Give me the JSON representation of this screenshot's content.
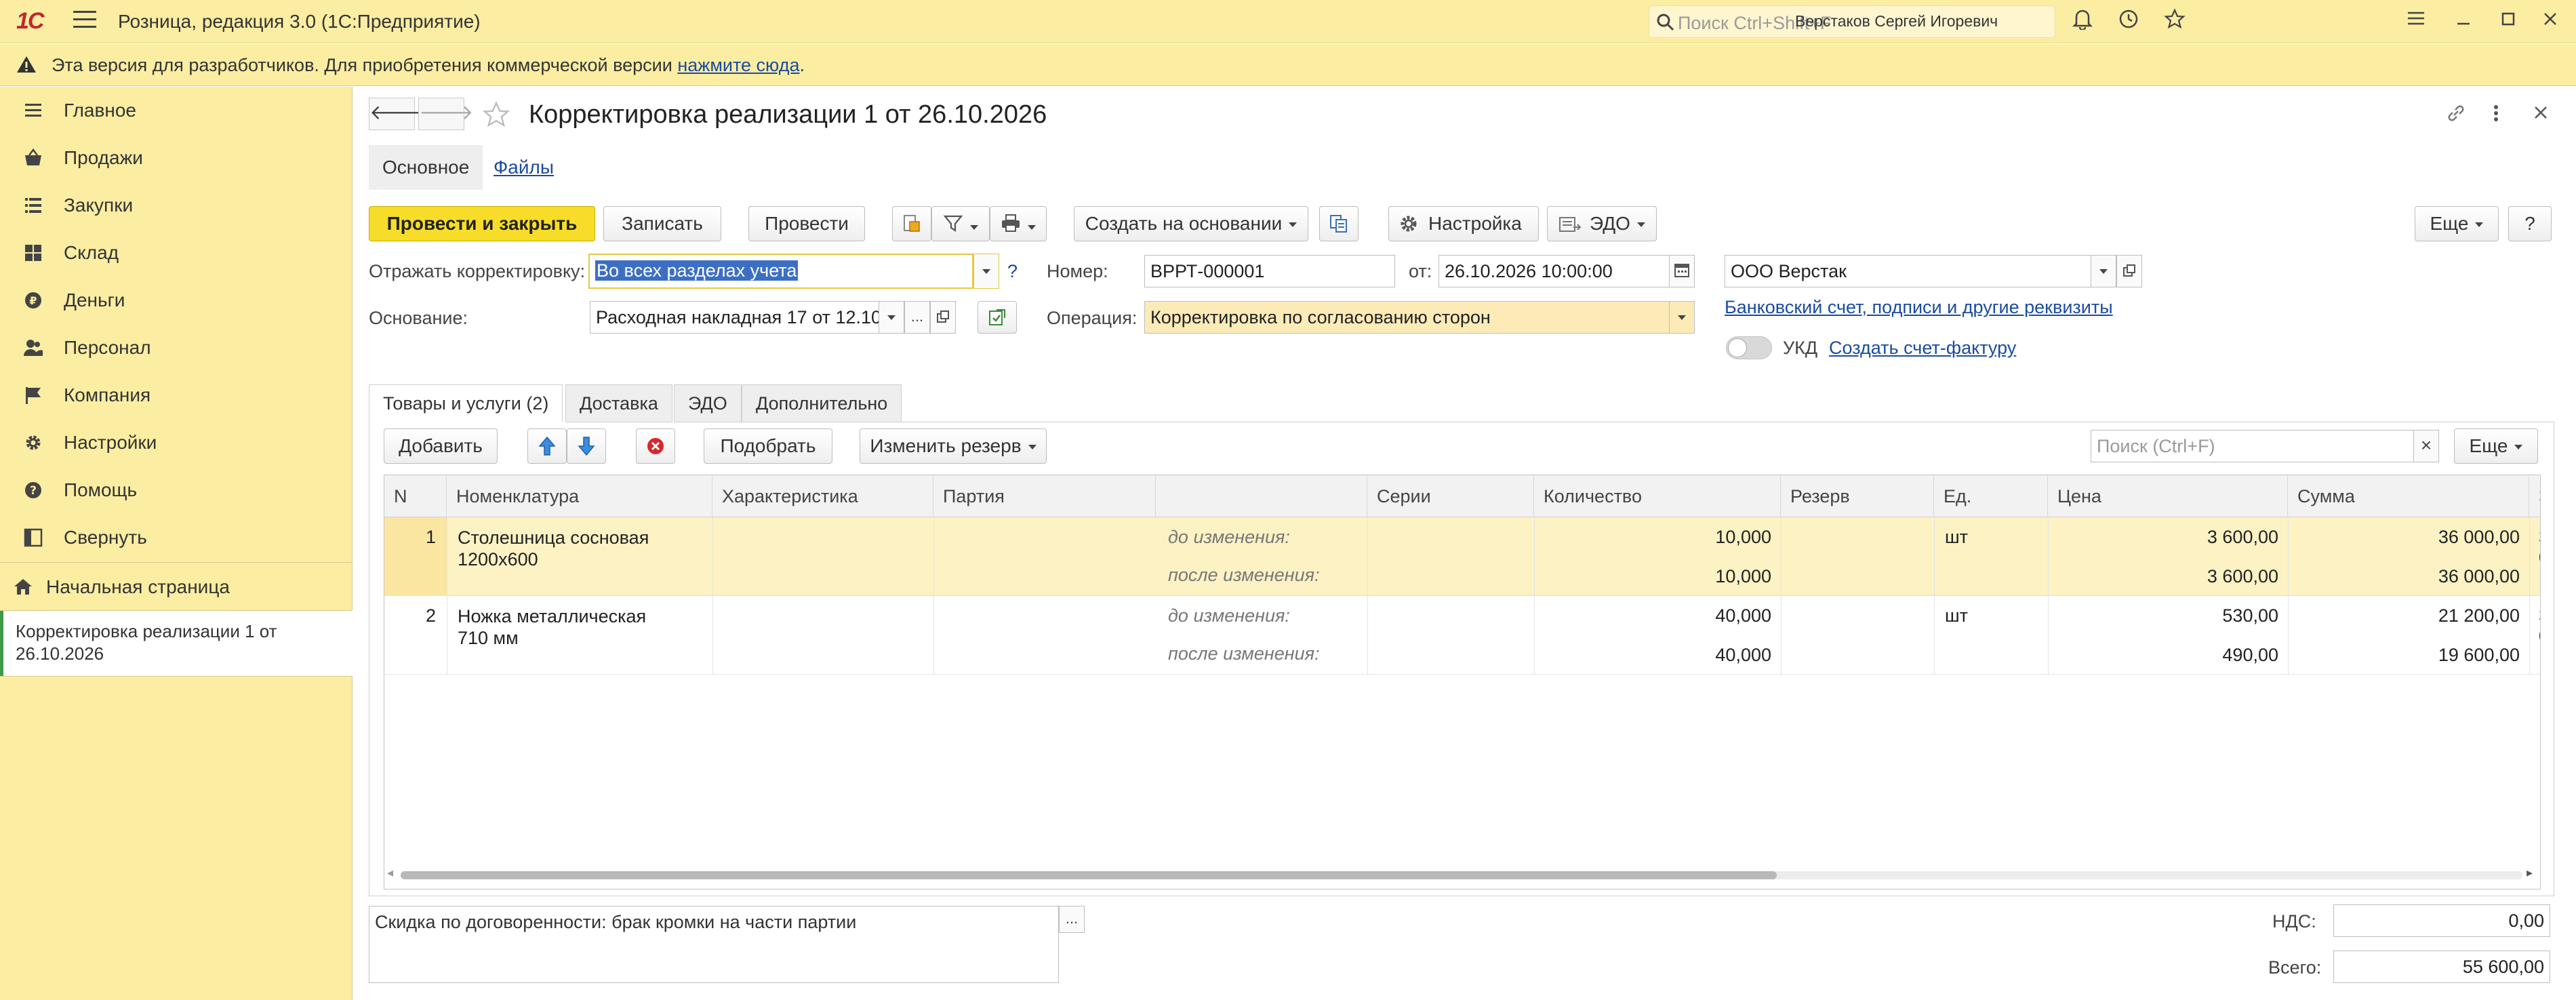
{
  "topbar": {
    "logo": "1С",
    "app_title": "Розница, редакция 3.0  (1С:Предприятие)",
    "search_placeholder": "Поиск Ctrl+Shift+F",
    "user": "Верстаков Сергей Игоревич"
  },
  "dev_banner": {
    "text": "Эта версия для разработчиков. Для приобретения коммерческой версии ",
    "link": "нажмите сюда",
    "tail": "."
  },
  "sidebar": {
    "items": [
      {
        "label": "Главное",
        "icon": "menu-icon"
      },
      {
        "label": "Продажи",
        "icon": "basket-icon"
      },
      {
        "label": "Закупки",
        "icon": "purchase-icon"
      },
      {
        "label": "Склад",
        "icon": "warehouse-icon"
      },
      {
        "label": "Деньги",
        "icon": "money-icon"
      },
      {
        "label": "Персонал",
        "icon": "people-icon"
      },
      {
        "label": "Компания",
        "icon": "flag-icon"
      },
      {
        "label": "Настройки",
        "icon": "gear-icon"
      },
      {
        "label": "Помощь",
        "icon": "help-icon"
      },
      {
        "label": "Свернуть",
        "icon": "collapse-icon"
      }
    ],
    "home": "Начальная страница",
    "current": "Корректировка реализации 1 от 26.10.2026"
  },
  "document": {
    "title": "Корректировка реализации 1 от 26.10.2026",
    "tabs_top": [
      "Основное",
      "Файлы"
    ]
  },
  "toolbar": {
    "post_close": "Провести и закрыть",
    "save": "Записать",
    "post": "Провести",
    "create_based": "Создать на основании",
    "settings": "Настройка",
    "edo": "ЭДО",
    "more": "Еще",
    "help": "?"
  },
  "form": {
    "reflect_label": "Отражать корректировку:",
    "reflect_value": "Во всех разделах учета",
    "reflect_hint": "?",
    "number_label": "Номер:",
    "number_value": "ВРРТ-000001",
    "date_label": "от:",
    "date_value": "26.10.2026 10:00:00",
    "org_value": "ООО Верстак",
    "basis_label": "Основание:",
    "basis_value": "Расходная накладная 17 от 12.10",
    "operation_label": "Операция:",
    "operation_value": "Корректировка по согласованию сторон",
    "bank_link": "Банковский счет, подписи и другие реквизиты",
    "ukd_label": "УКД",
    "invoice_link": "Создать счет-фактуру",
    "ellipsis": "..."
  },
  "tabs": [
    "Товары и услуги (2)",
    "Доставка",
    "ЭДО",
    "Дополнительно"
  ],
  "grid_toolbar": {
    "add": "Добавить",
    "pick": "Подобрать",
    "change_reserve": "Изменить резерв",
    "search_placeholder": "Поиск (Ctrl+F)",
    "clear": "×",
    "more": "Еще"
  },
  "grid": {
    "columns": [
      "N",
      "Номенклатура",
      "Характеристика",
      "Партия",
      "",
      "Серии",
      "Количество",
      "Резерв",
      "Ед.",
      "Цена",
      "Сумма",
      "З"
    ],
    "rows": [
      {
        "n": "1",
        "name_line1": "Столешница сосновая",
        "name_line2": "1200х600",
        "unit": "шт",
        "before_label": "до изменения:",
        "after_label": "после изменения:",
        "before": {
          "qty": "10,000",
          "price": "3 600,00",
          "sum": "36 000,00"
        },
        "after": {
          "qty": "10,000",
          "price": "3 600,00",
          "sum": "36 000,00"
        },
        "cut_before": "3",
        "cut_after": "0"
      },
      {
        "n": "2",
        "name_line1": "Ножка металлическая",
        "name_line2": "710 мм",
        "unit": "шт",
        "before_label": "до изменения:",
        "after_label": "после изменения:",
        "before": {
          "qty": "40,000",
          "price": "530,00",
          "sum": "21 200,00"
        },
        "after": {
          "qty": "40,000",
          "price": "490,00",
          "sum": "19 600,00"
        },
        "cut_before": "3",
        "cut_after": "0"
      }
    ],
    "scroll_left": "◂",
    "scroll_right": "▸"
  },
  "footer": {
    "comment": "Скидка по договоренности: брак кромки на части партии",
    "comment_btn": "...",
    "vat_label": "НДС:",
    "vat_value": "0,00",
    "total_label": "Всего:",
    "total_value": "55 600,00"
  },
  "colors": {
    "chrome": "#fbeda2",
    "primary_button": "#f7dd29",
    "selected_row": "#fdf2c4",
    "link": "#1a4ca0",
    "active_marker": "#3d9a48"
  }
}
